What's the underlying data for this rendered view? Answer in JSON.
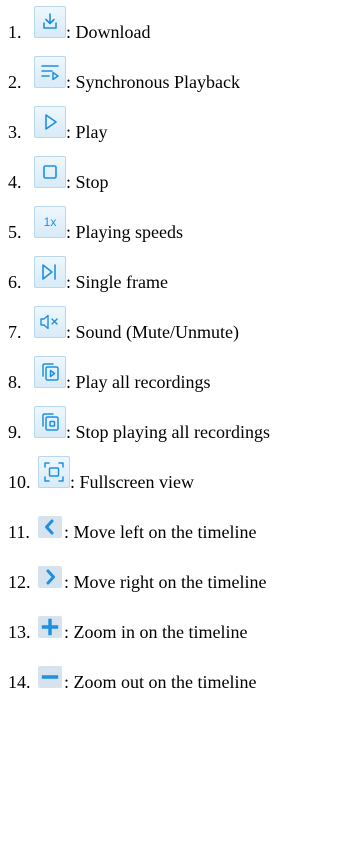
{
  "items": [
    {
      "number": "1.",
      "label": ": Download",
      "icon": "download-icon"
    },
    {
      "number": "2.",
      "label": ": Synchronous Playback",
      "icon": "sync-playback-icon"
    },
    {
      "number": "3.",
      "label": ": Play",
      "icon": "play-icon"
    },
    {
      "number": "4.",
      "label": ": Stop",
      "icon": "stop-icon"
    },
    {
      "number": "5.",
      "label": ": Playing speeds",
      "icon": "speed-1x-icon",
      "icon_text": "1x"
    },
    {
      "number": "6.",
      "label": ": Single frame",
      "icon": "single-frame-icon"
    },
    {
      "number": "7.",
      "label": ": Sound (Mute/Unmute)",
      "icon": "mute-icon"
    },
    {
      "number": "8.",
      "label": ": Play all recordings",
      "icon": "play-all-icon"
    },
    {
      "number": "9.",
      "label": ": Stop playing all recordings",
      "icon": "stop-all-icon"
    },
    {
      "number": "10.",
      "label": ": Fullscreen view",
      "icon": "fullscreen-icon"
    },
    {
      "number": "11.",
      "label": ": Move left on the timeline",
      "icon": "chevron-left-icon"
    },
    {
      "number": "12.",
      "label": ": Move right on the timeline",
      "icon": "chevron-right-icon"
    },
    {
      "number": "13.",
      "label": ": Zoom in on the timeline",
      "icon": "plus-icon"
    },
    {
      "number": "14.",
      "label": ": Zoom out on the timeline",
      "icon": "minus-icon"
    }
  ],
  "colors": {
    "icon_stroke": "#1e8fe1",
    "button_border": "#b9d7ee",
    "button_fill": "#e6f2fb",
    "timeline_button_fill": "#d6e3ef",
    "timeline_icon": "#1e8fe1"
  }
}
